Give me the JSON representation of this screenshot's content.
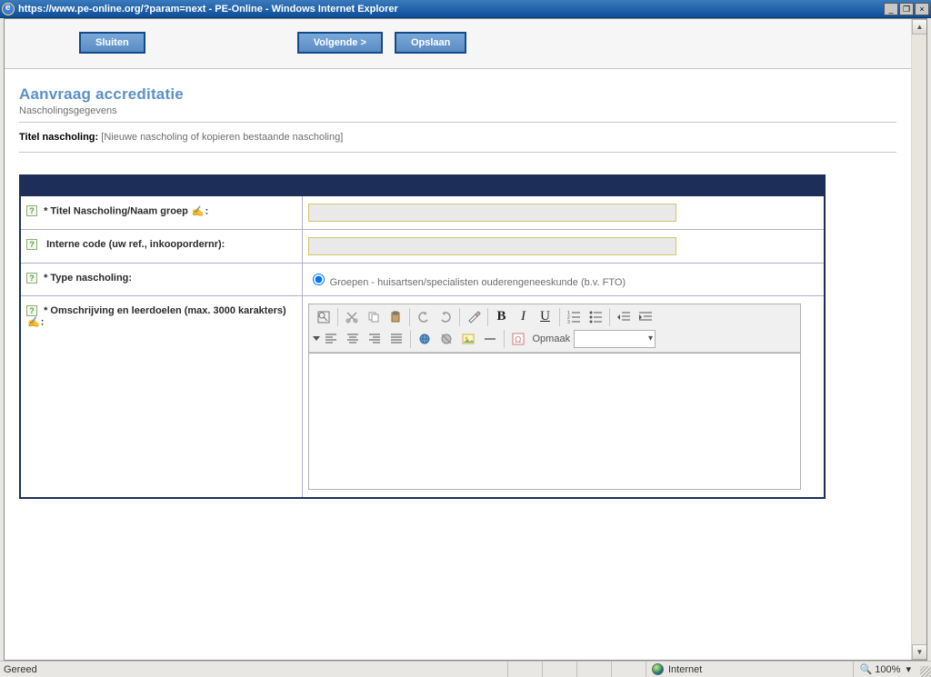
{
  "window": {
    "title": "https://www.pe-online.org/?param=next - PE-Online - Windows Internet Explorer",
    "min_symbol": "_",
    "max_symbol": "❐",
    "close_symbol": "×"
  },
  "toolbar": {
    "close": "Sluiten",
    "next": "Volgende >",
    "save": "Opslaan"
  },
  "section": {
    "title": "Aanvraag accreditatie",
    "subtitle": "Nascholingsgegevens"
  },
  "breadcrumb": {
    "label": "Titel nascholing:",
    "value": "[Nieuwe nascholing of kopieren bestaande nascholing]"
  },
  "form": {
    "help_char": "?",
    "req_char": "*",
    "spell_char": "✍",
    "rows": {
      "title": {
        "label": "Titel Nascholing/Naam groep"
      },
      "code": {
        "label": "Interne code (uw ref., inkoopordernr):"
      },
      "type": {
        "label": "Type nascholing:",
        "option": "Groepen - huisartsen/specialisten ouderengeneeskunde (b.v. FTO)"
      },
      "desc": {
        "label": "Omschrijving en leerdoelen (max. 3000 karakters)"
      }
    }
  },
  "rte": {
    "format_label": "Opmaak"
  },
  "status": {
    "ready": "Gereed",
    "zone": "Internet",
    "zoom": "100%"
  }
}
